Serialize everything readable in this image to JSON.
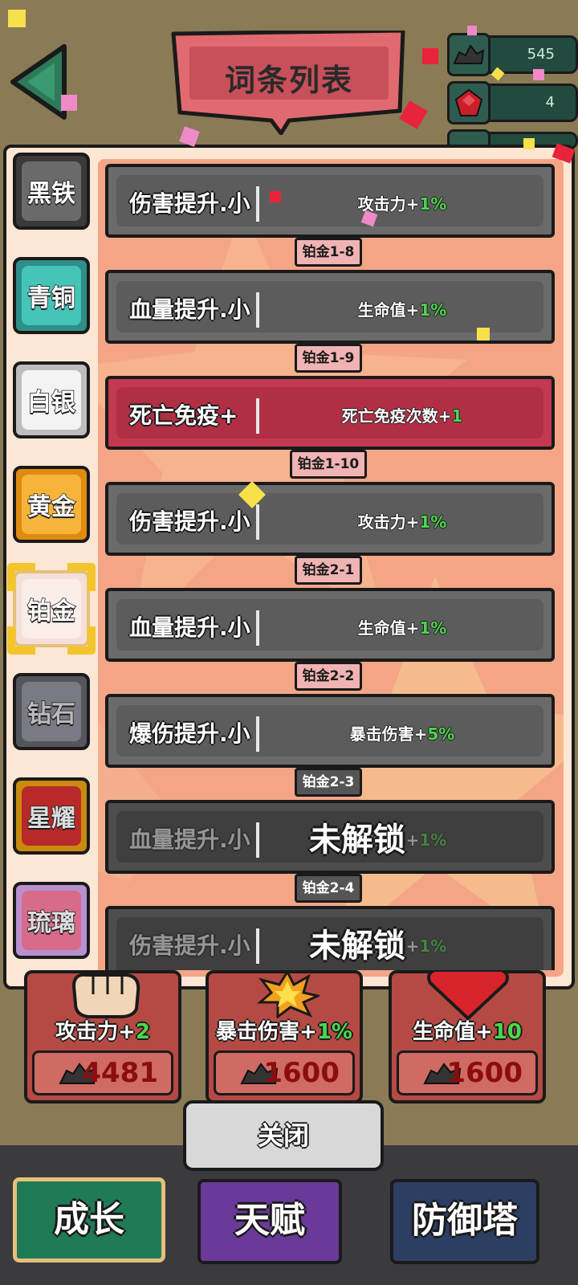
{
  "header": {
    "title": "词条列表",
    "resources": [
      {
        "icon": "ore-icon",
        "value": "545"
      },
      {
        "icon": "ruby-icon",
        "value": "4"
      },
      {
        "icon": "orb-icon",
        "value": ""
      }
    ]
  },
  "tiers": [
    {
      "label": "黑铁",
      "color": "#5a5a5a"
    },
    {
      "label": "青铜",
      "color": "#3fb7ae"
    },
    {
      "label": "白银",
      "color": "#e8e8e8"
    },
    {
      "label": "黄金",
      "color": "#f3a020"
    },
    {
      "label": "铂金",
      "color": "#f4e0d8",
      "selected": true
    },
    {
      "label": "钻石",
      "color": "#6d6d75"
    },
    {
      "label": "星耀",
      "color": "#d8a020"
    },
    {
      "label": "琉璃",
      "color": "#c8a0d8"
    }
  ],
  "entries": [
    {
      "name": "伤害提升.小",
      "effect_prefix": "攻击力+",
      "effect_value": "1%",
      "style": "normal",
      "level": "铂金1-8"
    },
    {
      "name": "血量提升.小",
      "effect_prefix": "生命值+",
      "effect_value": "1%",
      "style": "normal",
      "level": "铂金1-9"
    },
    {
      "name": "死亡免疫+",
      "effect_prefix": "死亡免疫次数+",
      "effect_value": "1",
      "style": "red",
      "level": "铂金1-10"
    },
    {
      "name": "伤害提升.小",
      "effect_prefix": "攻击力+",
      "effect_value": "1%",
      "style": "normal",
      "level": "铂金2-1"
    },
    {
      "name": "血量提升.小",
      "effect_prefix": "生命值+",
      "effect_value": "1%",
      "style": "normal",
      "level": "铂金2-2"
    },
    {
      "name": "爆伤提升.小",
      "effect_prefix": "暴击伤害+",
      "effect_value": "5%",
      "style": "normal",
      "level": "铂金2-3"
    },
    {
      "name": "血量提升.小",
      "effect_prefix": "生命值+",
      "effect_value": "1%",
      "style": "locked",
      "locked_label": "未解锁",
      "level": "铂金2-4"
    },
    {
      "name": "伤害提升.小",
      "effect_prefix": "攻击力+",
      "effect_value": "1%",
      "style": "locked",
      "locked_label": "未解锁"
    }
  ],
  "cards": [
    {
      "label_prefix": "攻击力+",
      "label_value": "2",
      "cost": "4481",
      "icon": "fist-icon"
    },
    {
      "label_prefix": "暴击伤害+",
      "label_value": "1%",
      "cost": "1600",
      "icon": "explosion-icon"
    },
    {
      "label_prefix": "生命值+",
      "label_value": "10",
      "cost": "1600",
      "icon": "heart-icon"
    }
  ],
  "close_label": "关闭",
  "nav": [
    {
      "label": "成长",
      "color": "#1f7a55"
    },
    {
      "label": "天赋",
      "color": "#6a3a9a"
    },
    {
      "label": "防御塔",
      "color": "#2c3f63"
    }
  ]
}
